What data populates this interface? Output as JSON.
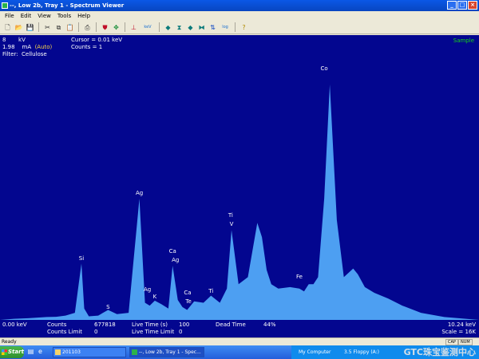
{
  "window": {
    "title": "--, Low 2b, Tray 1 - Spectrum Viewer",
    "minimize": "_",
    "maximize": "□",
    "close": "×"
  },
  "menu": [
    "File",
    "Edit",
    "View",
    "Tools",
    "Help"
  ],
  "toolbar": {
    "kev_label": "keV",
    "log_label": "log"
  },
  "info": {
    "kv_value": "8",
    "kv_unit": "kV",
    "ma_value": "1.98",
    "ma_unit": "mA",
    "auto": "(Auto)",
    "filter": "Filter:  Cellulose",
    "cursor": "Cursor = 0.01 keV",
    "counts": "Counts = 1",
    "sample": "Sample"
  },
  "peaks": [
    {
      "label": "Si"
    },
    {
      "label": "S"
    },
    {
      "label": "Ag"
    },
    {
      "label": "Ag"
    },
    {
      "label": "K"
    },
    {
      "label": "Ca"
    },
    {
      "label": "Ag"
    },
    {
      "label": "Ca"
    },
    {
      "label": "Te"
    },
    {
      "label": "Ti"
    },
    {
      "label": "Ti"
    },
    {
      "label": "V"
    },
    {
      "label": "Fe"
    },
    {
      "label": "Co"
    }
  ],
  "bottom": {
    "start_kev": "0.00 keV",
    "counts_label": "Counts",
    "counts_value": "677818",
    "counts_limit_label": "Counts Limit",
    "counts_limit_value": "0",
    "live_time_label": "Live Time (s)",
    "live_time_value": "100",
    "live_time_limit_label": "Live Time Limit",
    "live_time_limit_value": "0",
    "dead_time_label": "Dead Time",
    "dead_time_value": "44%",
    "end_kev": "10.24 keV",
    "scale": "Scale = 16K"
  },
  "status": {
    "text": "Ready",
    "cap": "CAP",
    "num": "NUM"
  },
  "taskbar": {
    "start": "Start",
    "task1": "201103",
    "task2": "--, Low 2b, Tray 1 - Spec...",
    "tray1": "My Computer",
    "tray2": "3.5 Floppy (A:)",
    "watermark": "GTC珠宝鉴测中心"
  },
  "chart_data": {
    "type": "area",
    "xlim": [
      0.0,
      10.24
    ],
    "x_unit": "keV",
    "scale_max_counts": 16000,
    "fill_color": "#4d9ff2",
    "background": "#03068f",
    "x": [
      0.0,
      0.3,
      0.6,
      1.0,
      1.2,
      1.4,
      1.6,
      1.74,
      1.8,
      1.9,
      2.1,
      2.31,
      2.5,
      2.75,
      2.98,
      3.1,
      3.2,
      3.31,
      3.45,
      3.6,
      3.69,
      3.8,
      3.9,
      4.0,
      4.15,
      4.35,
      4.51,
      4.7,
      4.85,
      4.95,
      5.1,
      5.3,
      5.5,
      5.6,
      5.7,
      5.8,
      5.95,
      6.2,
      6.4,
      6.5,
      6.6,
      6.7,
      6.8,
      6.93,
      7.05,
      7.2,
      7.35,
      7.55,
      7.65,
      7.8,
      8.0,
      8.3,
      8.6,
      9.0,
      9.5,
      10.24
    ],
    "y": [
      0,
      80,
      120,
      200,
      220,
      300,
      500,
      3950,
      800,
      250,
      300,
      700,
      400,
      500,
      8500,
      1200,
      1000,
      1350,
      1100,
      800,
      3800,
      1400,
      900,
      700,
      1300,
      1200,
      1700,
      1200,
      2200,
      6300,
      2500,
      3000,
      6800,
      5800,
      3500,
      2500,
      2200,
      2300,
      2200,
      2000,
      2500,
      2500,
      3000,
      8500,
      16500,
      7000,
      3000,
      3600,
      3200,
      2300,
      1900,
      1500,
      1000,
      500,
      200,
      0
    ],
    "peak_labels": [
      {
        "label": "Si",
        "x": 1.74,
        "y": 4300
      },
      {
        "label": "S",
        "x": 2.31,
        "y": 900
      },
      {
        "label": "Ag",
        "x": 2.98,
        "y": 8900
      },
      {
        "label": "Ag",
        "x": 3.15,
        "y": 2100
      },
      {
        "label": "K",
        "x": 3.31,
        "y": 1600
      },
      {
        "label": "Ca",
        "x": 3.69,
        "y": 4800
      },
      {
        "label": "Ag",
        "x": 3.75,
        "y": 4200
      },
      {
        "label": "Ca",
        "x": 4.01,
        "y": 1900
      },
      {
        "label": "Te",
        "x": 4.03,
        "y": 1300
      },
      {
        "label": "Ti",
        "x": 4.51,
        "y": 2000
      },
      {
        "label": "Ti",
        "x": 4.93,
        "y": 7300
      },
      {
        "label": "V",
        "x": 4.95,
        "y": 6700
      },
      {
        "label": "Fe",
        "x": 6.4,
        "y": 3000
      },
      {
        "label": "Co",
        "x": 6.93,
        "y": 17600
      }
    ]
  }
}
